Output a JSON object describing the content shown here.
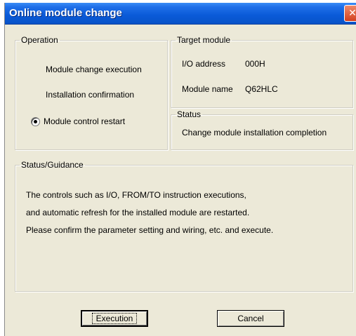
{
  "window": {
    "title": "Online module change",
    "close_glyph": "✕"
  },
  "operation": {
    "legend": "Operation",
    "items": [
      {
        "label": "Module change execution",
        "selected": false
      },
      {
        "label": "Installation confirmation",
        "selected": false
      },
      {
        "label": "Module control restart",
        "selected": true
      }
    ]
  },
  "target_module": {
    "legend": "Target module",
    "io_address_label": "I/O address",
    "io_address_value": "000H",
    "module_name_label": "Module name",
    "module_name_value": "Q62HLC"
  },
  "status": {
    "legend": "Status",
    "text": "Change module installation completion"
  },
  "guidance": {
    "legend": "Status/Guidance",
    "lines": [
      "The controls such as I/O, FROM/TO instruction executions,",
      "and automatic refresh for the installed module are restarted.",
      "Please confirm the parameter setting and wiring, etc. and execute."
    ]
  },
  "buttons": {
    "execution": "Execution",
    "cancel": "Cancel"
  },
  "colors": {
    "title_bar": "#0a5ad8",
    "dialog_bg": "#ece9d8",
    "close_button": "#d2401e"
  }
}
